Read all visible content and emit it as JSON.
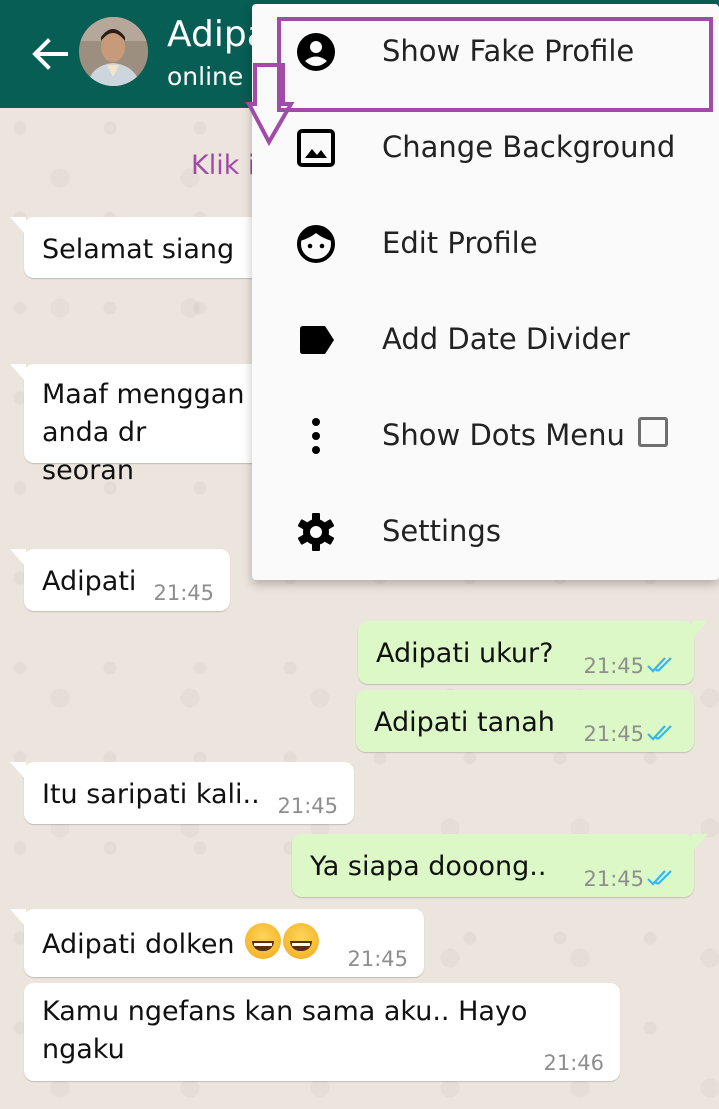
{
  "header": {
    "back_icon": "arrow-left-icon",
    "contact_name": "Adipati",
    "status": "online",
    "colors": {
      "bar": "#075e54",
      "text": "#ffffff"
    }
  },
  "menu": {
    "items": [
      {
        "label": "Show Fake Profile",
        "icon": "account-circle-icon"
      },
      {
        "label": "Change Background",
        "icon": "image-icon"
      },
      {
        "label": "Edit Profile",
        "icon": "face-icon"
      },
      {
        "label": "Add Date Divider",
        "icon": "label-tag-icon"
      },
      {
        "label": "Show Dots Menu",
        "icon": "more-vert-icon",
        "checkbox": false
      },
      {
        "label": "Settings",
        "icon": "gear-icon"
      }
    ]
  },
  "annotation": {
    "text": "Klik ini",
    "color": "#a14aa8"
  },
  "messages": [
    {
      "direction": "in",
      "text": "Selamat siang",
      "time": ""
    },
    {
      "direction": "in",
      "text": "Maaf menggan\nanda dr seoran",
      "time": ""
    },
    {
      "direction": "in",
      "text": "Adipati",
      "time": "21:45"
    },
    {
      "direction": "out",
      "text": "Adipati ukur?",
      "time": "21:45",
      "read": true
    },
    {
      "direction": "out",
      "text": "Adipati tanah",
      "time": "21:45",
      "read": true
    },
    {
      "direction": "in",
      "text": "Itu saripati kali..",
      "time": "21:45"
    },
    {
      "direction": "out",
      "text": "Ya siapa dooong..",
      "time": "21:45",
      "read": true
    },
    {
      "direction": "in",
      "text": "Adipati dolken",
      "emoji": "grinning-face-smiling-eyes x2",
      "time": "21:45"
    },
    {
      "direction": "in",
      "text": "Kamu ngefans kan sama aku.. Hayo\nngaku",
      "time": "21:46"
    }
  ],
  "colors": {
    "outgoing_bubble": "#dcf8c6",
    "incoming_bubble": "#ffffff",
    "read_ticks": "#34b7f1",
    "chat_background": "#ece5dd"
  }
}
